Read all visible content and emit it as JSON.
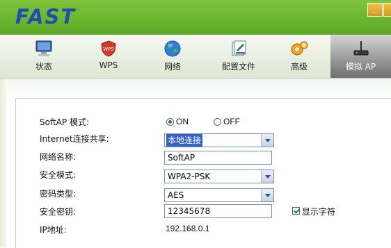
{
  "app": {
    "logo": "FAST"
  },
  "window_controls": {
    "minimize": "_"
  },
  "tabs": [
    {
      "label": "状态",
      "icon": "monitor-icon"
    },
    {
      "label": "WPS",
      "icon": "wps-icon"
    },
    {
      "label": "网络",
      "icon": "globe-icon"
    },
    {
      "label": "配置文件",
      "icon": "profile-icon"
    },
    {
      "label": "高级",
      "icon": "gears-icon"
    },
    {
      "label": "模拟 AP",
      "icon": "router-icon"
    }
  ],
  "active_tab": "模拟 AP",
  "form": {
    "softap_mode": {
      "label": "SoftAP 模式:",
      "options": [
        "ON",
        "OFF"
      ],
      "selected": "ON"
    },
    "internet_share": {
      "label": "Internet连接共享:",
      "value": "本地连接"
    },
    "ssid": {
      "label": "网络名称:",
      "value": "SoftAP"
    },
    "security_mode": {
      "label": "安全模式:",
      "value": "WPA2-PSK"
    },
    "cipher_type": {
      "label": "密码类型:",
      "value": "AES"
    },
    "security_key": {
      "label": "安全密钥:",
      "value": "12345678",
      "show_chars_label": "显示字符",
      "show_chars_checked": true
    },
    "ip_address": {
      "label": "IP地址:",
      "value": "192.168.0.1"
    }
  },
  "colors": {
    "header_green": "#6cb52f",
    "logo_blue": "#1c4fae",
    "selection_blue": "#3162c8"
  }
}
